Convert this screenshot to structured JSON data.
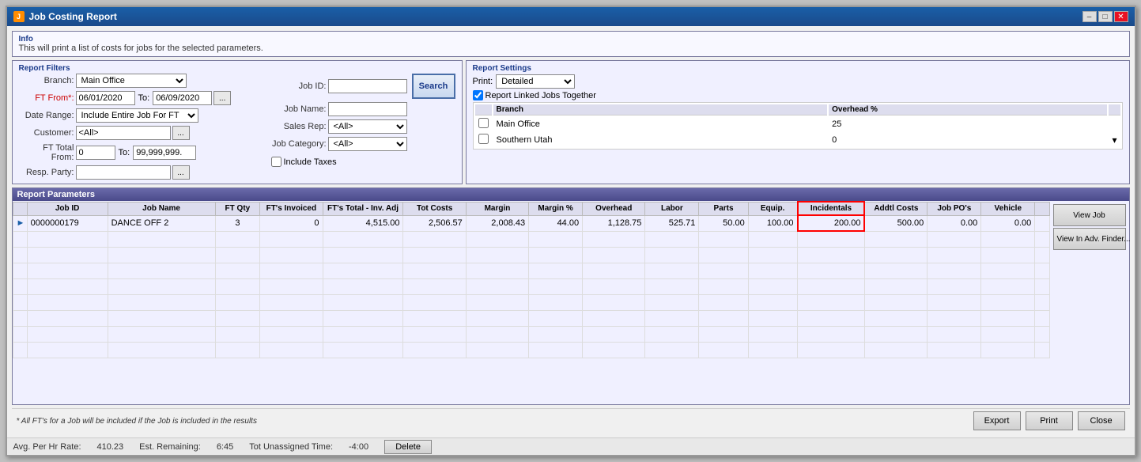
{
  "window": {
    "title": "Job Costing Report",
    "icon": "J"
  },
  "info": {
    "header": "Info",
    "text": "This will print a list of costs for jobs for the selected parameters."
  },
  "filters": {
    "header": "Report Filters",
    "branch_label": "Branch:",
    "branch_value": "Main Office",
    "ft_from_label": "FT From*:",
    "ft_from_value": "06/01/2020",
    "ft_to_label": "To:",
    "ft_to_value": "06/09/2020",
    "date_range_label": "Date Range:",
    "date_range_value": "Include Entire Job For FT",
    "customer_label": "Customer:",
    "customer_value": "<All>",
    "ft_total_from_label": "FT Total From:",
    "ft_total_from_value": "0",
    "ft_total_to_label": "To:",
    "ft_total_to_value": "99,999,999.",
    "resp_party_label": "Resp. Party:",
    "job_id_label": "Job ID:",
    "job_id_value": "",
    "job_name_label": "Job Name:",
    "job_name_value": "",
    "sales_rep_label": "Sales Rep:",
    "sales_rep_value": "<All>",
    "job_category_label": "Job Category:",
    "job_category_value": "<All>",
    "include_taxes_label": "Include Taxes",
    "search_label": "Search"
  },
  "settings": {
    "header": "Report Settings",
    "print_label": "Print:",
    "print_value": "Detailed",
    "linked_jobs_label": "Report Linked Jobs Together",
    "linked_jobs_checked": true,
    "overhead_cols": [
      "Branch",
      "Overhead %"
    ],
    "overhead_rows": [
      {
        "checked": false,
        "branch": "Main Office",
        "overhead": "25"
      },
      {
        "checked": false,
        "branch": "Southern Utah",
        "overhead": "0"
      }
    ]
  },
  "params": {
    "header": "Report Parameters",
    "columns": [
      "",
      "Job ID",
      "Job Name",
      "FT Qty",
      "FT's Invoiced",
      "FT's Total - Inv. Adj",
      "Tot Costs",
      "Margin",
      "Margin %",
      "Overhead",
      "Labor",
      "Parts",
      "Equip.",
      "Incidentals",
      "Addtl Costs",
      "Job PO's",
      "Vehicle",
      ""
    ],
    "rows": [
      {
        "indicator": "▶",
        "job_id": "0000000179",
        "job_name": "DANCE OFF 2",
        "ft_qty": "3",
        "ft_invoiced": "0",
        "ft_total": "4,515.00",
        "tot_costs": "2,506.57",
        "margin": "2,008.43",
        "margin_pct": "44.00",
        "overhead": "1,128.75",
        "labor": "525.71",
        "parts": "50.00",
        "equip": "100.00",
        "incidentals": "200.00",
        "addtl_costs": "500.00",
        "job_pos": "0.00",
        "vehicle": "0.00"
      }
    ],
    "view_job_label": "View Job",
    "view_finder_label": "View In Adv. Finder..."
  },
  "bottom": {
    "note": "* All FT's for a Job will be included if the Job is included in the results",
    "export_label": "Export",
    "print_label": "Print",
    "close_label": "Close"
  },
  "status_bar": {
    "avg_hr_rate_label": "Avg. Per Hr Rate:",
    "avg_hr_rate_value": "410.23",
    "est_remaining_label": "Est. Remaining:",
    "est_remaining_value": "6:45",
    "tot_unassigned_label": "Tot Unassigned Time:",
    "tot_unassigned_value": "-4:00",
    "delete_label": "Delete"
  }
}
